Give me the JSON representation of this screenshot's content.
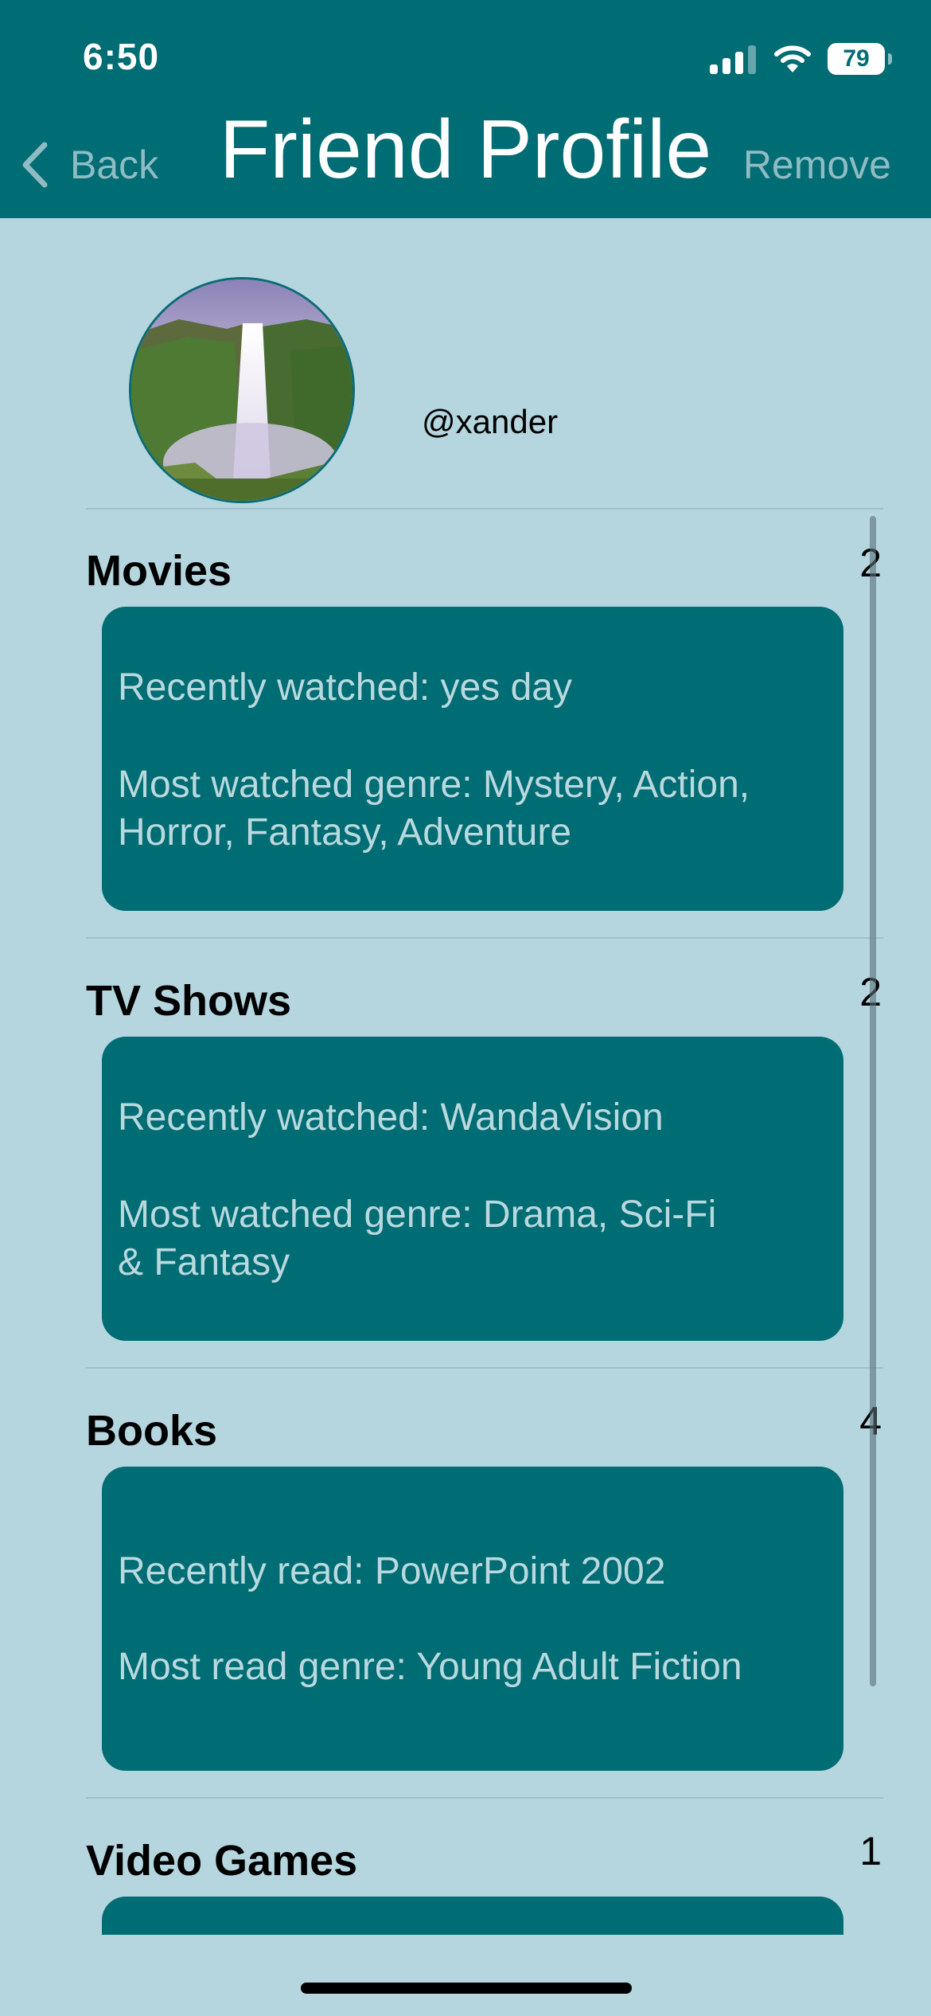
{
  "status_bar": {
    "time": "6:50",
    "battery": "79",
    "icons": [
      "signal-icon",
      "wifi-icon",
      "battery-icon"
    ]
  },
  "nav": {
    "back_label": "Back",
    "title": "Friend Profile",
    "remove_label": "Remove"
  },
  "profile": {
    "username": "@xander",
    "avatar": "waterfall-photo"
  },
  "sections": [
    {
      "title": "Movies",
      "count": "2",
      "lines": [
        "Recently watched: yes day",
        "Most watched genre: Mystery, Action,",
        "Horror, Fantasy, Adventure"
      ]
    },
    {
      "title": "TV Shows",
      "count": "2",
      "lines": [
        "Recently watched: WandaVision",
        "Most watched genre: Drama, Sci-Fi",
        "& Fantasy"
      ]
    },
    {
      "title": "Books",
      "count": "4",
      "lines": [
        "Recently read: PowerPoint 2002",
        "Most read genre: Young Adult Fiction"
      ]
    },
    {
      "title": "Video Games",
      "count": "1"
    }
  ],
  "colors": {
    "header": "#006c73",
    "background": "#b5d6df",
    "card": "#006c73",
    "card_text": "#b9d9de",
    "nav_muted": "#8fbcc4"
  }
}
